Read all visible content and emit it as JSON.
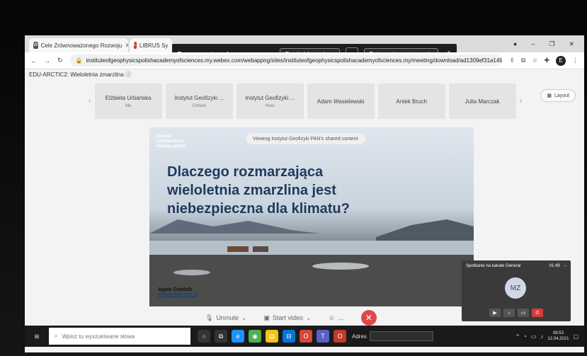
{
  "tabs": [
    {
      "label": "Cele Zrównoważonego Rozwoju",
      "favicon": "W",
      "color": "#555555"
    },
    {
      "label": "LIBRUS Sy",
      "favicon": "L",
      "color": "#c0392b"
    }
  ],
  "window_controls": {
    "minimize": "–",
    "restore": "❐",
    "close": "✕"
  },
  "share_bar": {
    "status": "Trwa prezentowanie...",
    "pass_control": "Przekaż kontrolę",
    "stop_sharing": "Zatrzymaj prezentowanie"
  },
  "address": {
    "url": "instituteofgeophysicspolishacademyofsciences.my.webex.com/webappng/sites/instituteofgeophysicspolishacademyofsciences.my/meeting/download/ad1309ef31a149..."
  },
  "meeting": {
    "title": "EDU-ARCTIC2: Wieloletnia zmarzlina"
  },
  "participants": [
    {
      "name": "Elżbieta Urbańska",
      "role": "Me"
    },
    {
      "name": "Instytut Geofizyki ...",
      "role": "Cohost"
    },
    {
      "name": "Instytut Geofizyki ...",
      "role": "Host"
    },
    {
      "name": "Adam Wasielewski",
      "role": ""
    },
    {
      "name": "Antek Bruch",
      "role": ""
    },
    {
      "name": "Julia Marczak",
      "role": ""
    }
  ],
  "layout_label": "Layout",
  "slide": {
    "viewing": "Viewing Instytut Geofizyki PAN's shared content",
    "logo_lines": [
      "Iceland",
      "Liechtenstein",
      "Norway grants"
    ],
    "title_lines": [
      "Dlaczego rozmarzająca",
      "wieloletnia zmarzlina jest",
      "niebezpieczna dla klimatu?"
    ],
    "author": "Agata Goździk",
    "email": "agdzik@igf.edu.pl"
  },
  "mini_window": {
    "title": "Spotkanie na kanale General",
    "timer": "01:49",
    "initials": "MZ"
  },
  "controls": {
    "unmute": "Unmute",
    "start_video": "Start video"
  },
  "taskbar": {
    "search_placeholder": "Wpisz tu wyszukiwane słowa",
    "address_label": "Adres",
    "time": "08:53",
    "date": "12.04.2021"
  }
}
